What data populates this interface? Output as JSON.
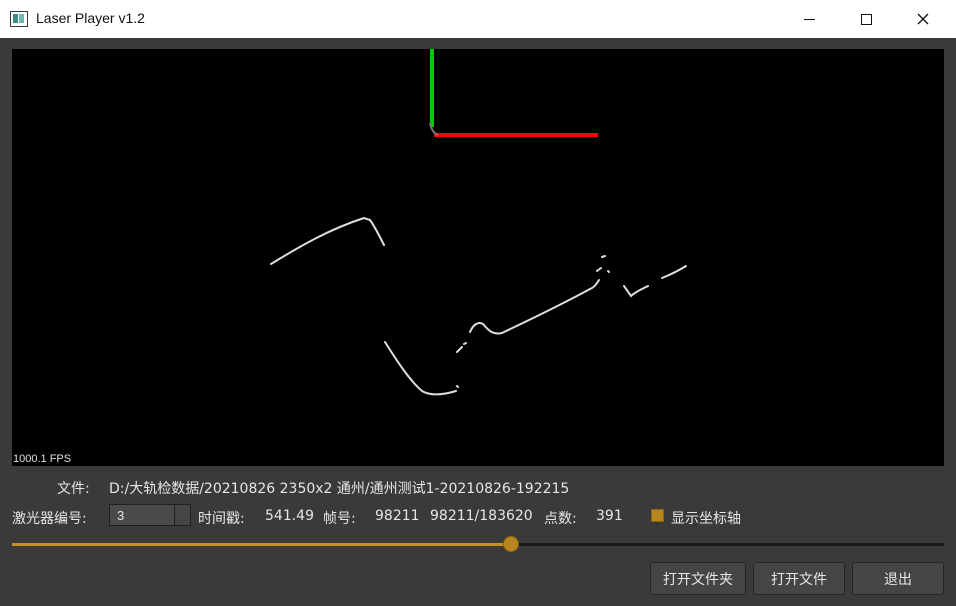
{
  "window": {
    "title": "Laser Player v1.2",
    "icon": "app-icon"
  },
  "viewer": {
    "fps_label": "1000.1 FPS",
    "background": "#000000",
    "axis_x_color": "#ff0000",
    "axis_y_color": "#00cc00",
    "points_color": "#dddddd"
  },
  "info": {
    "file_label": "文件:",
    "file_path": "D:/大轨检数据/20210826 2350x2 通州/通州测试1-20210826-192215",
    "laser_label": "激光器编号:",
    "laser_value": "3",
    "timestamp_label": "时间戳:",
    "timestamp_value": "541.49",
    "frame_label": "帧号:",
    "frame_value": "98211",
    "frame_progress": "98211/183620",
    "points_label": "点数:",
    "points_value": "391",
    "show_axis_label": "显示坐标轴",
    "show_axis_checked": true
  },
  "slider": {
    "fraction": 0.5349,
    "accent": "#c48f23"
  },
  "buttons": {
    "open_folder": "打开文件夹",
    "open_file": "打开文件",
    "exit": "退出"
  }
}
